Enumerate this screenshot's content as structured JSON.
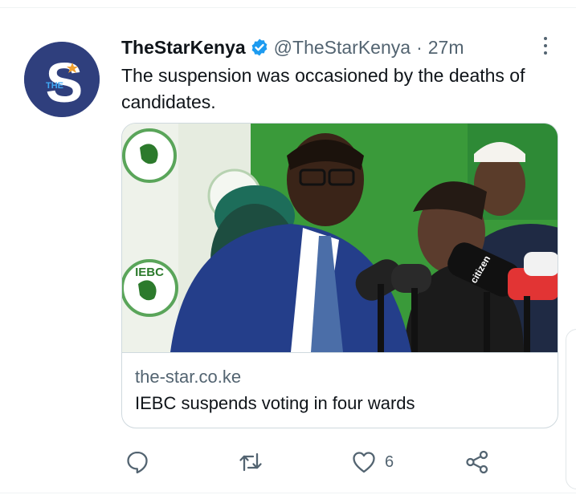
{
  "tweet": {
    "display_name": "TheStarKenya",
    "handle": "@TheStarKenya",
    "separator": "·",
    "time": "27m",
    "text": "The suspension was occasioned by the deaths of candidates.",
    "avatar_letter": "S",
    "avatar_small": "THE",
    "verified_icon": "verified-badge-icon",
    "more_icon": "more-vertical-icon"
  },
  "card": {
    "domain": "the-star.co.ke",
    "title": "IEBC suspends voting in four wards",
    "image_logo_text": "IEBC",
    "image_mic_text": "citizen"
  },
  "actions": {
    "reply_icon": "reply-icon",
    "retweet_icon": "retweet-icon",
    "like_icon": "heart-icon",
    "like_count": "6",
    "share_icon": "share-icon"
  },
  "colors": {
    "accent": "#1d9bf0",
    "secondary_text": "#536471",
    "avatar_bg": "#2f3f7d"
  }
}
